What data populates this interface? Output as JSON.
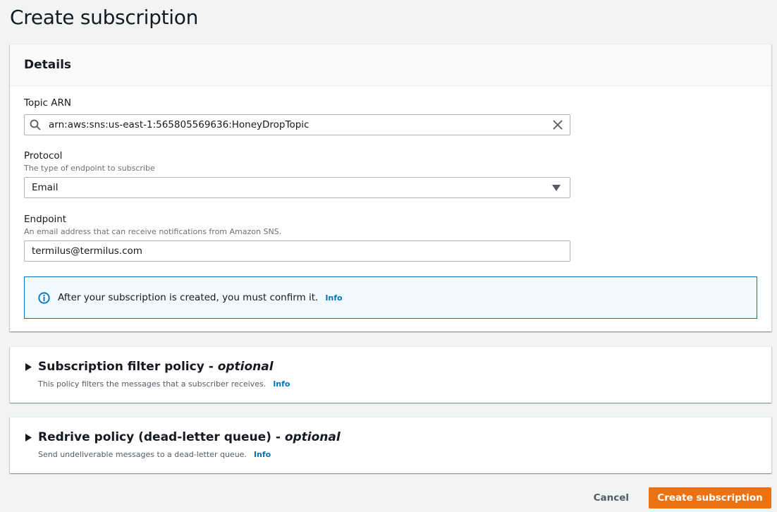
{
  "page": {
    "title": "Create subscription"
  },
  "details": {
    "header": "Details",
    "topic_arn": {
      "label": "Topic ARN",
      "value": "arn:aws:sns:us-east-1:565805569636:HoneyDropTopic"
    },
    "protocol": {
      "label": "Protocol",
      "description": "The type of endpoint to subscribe",
      "value": "Email"
    },
    "endpoint": {
      "label": "Endpoint",
      "description": "An email address that can receive notifications from Amazon SNS.",
      "value": "termilus@termilus.com"
    },
    "alert": {
      "text": "After your subscription is created, you must confirm it.",
      "link": "Info"
    }
  },
  "filter_policy": {
    "title": "Subscription filter policy",
    "optional": "optional",
    "dash": " - ",
    "description": "This policy filters the messages that a subscriber receives.",
    "link": "Info"
  },
  "redrive_policy": {
    "title": "Redrive policy (dead-letter queue)",
    "optional": "optional",
    "dash": " - ",
    "description": "Send undeliverable messages to a dead-letter queue.",
    "link": "Info"
  },
  "actions": {
    "cancel": "Cancel",
    "create": "Create subscription"
  },
  "colors": {
    "primary": "#ec7211",
    "link": "#0073bb",
    "alert_bg": "#f1faff"
  }
}
